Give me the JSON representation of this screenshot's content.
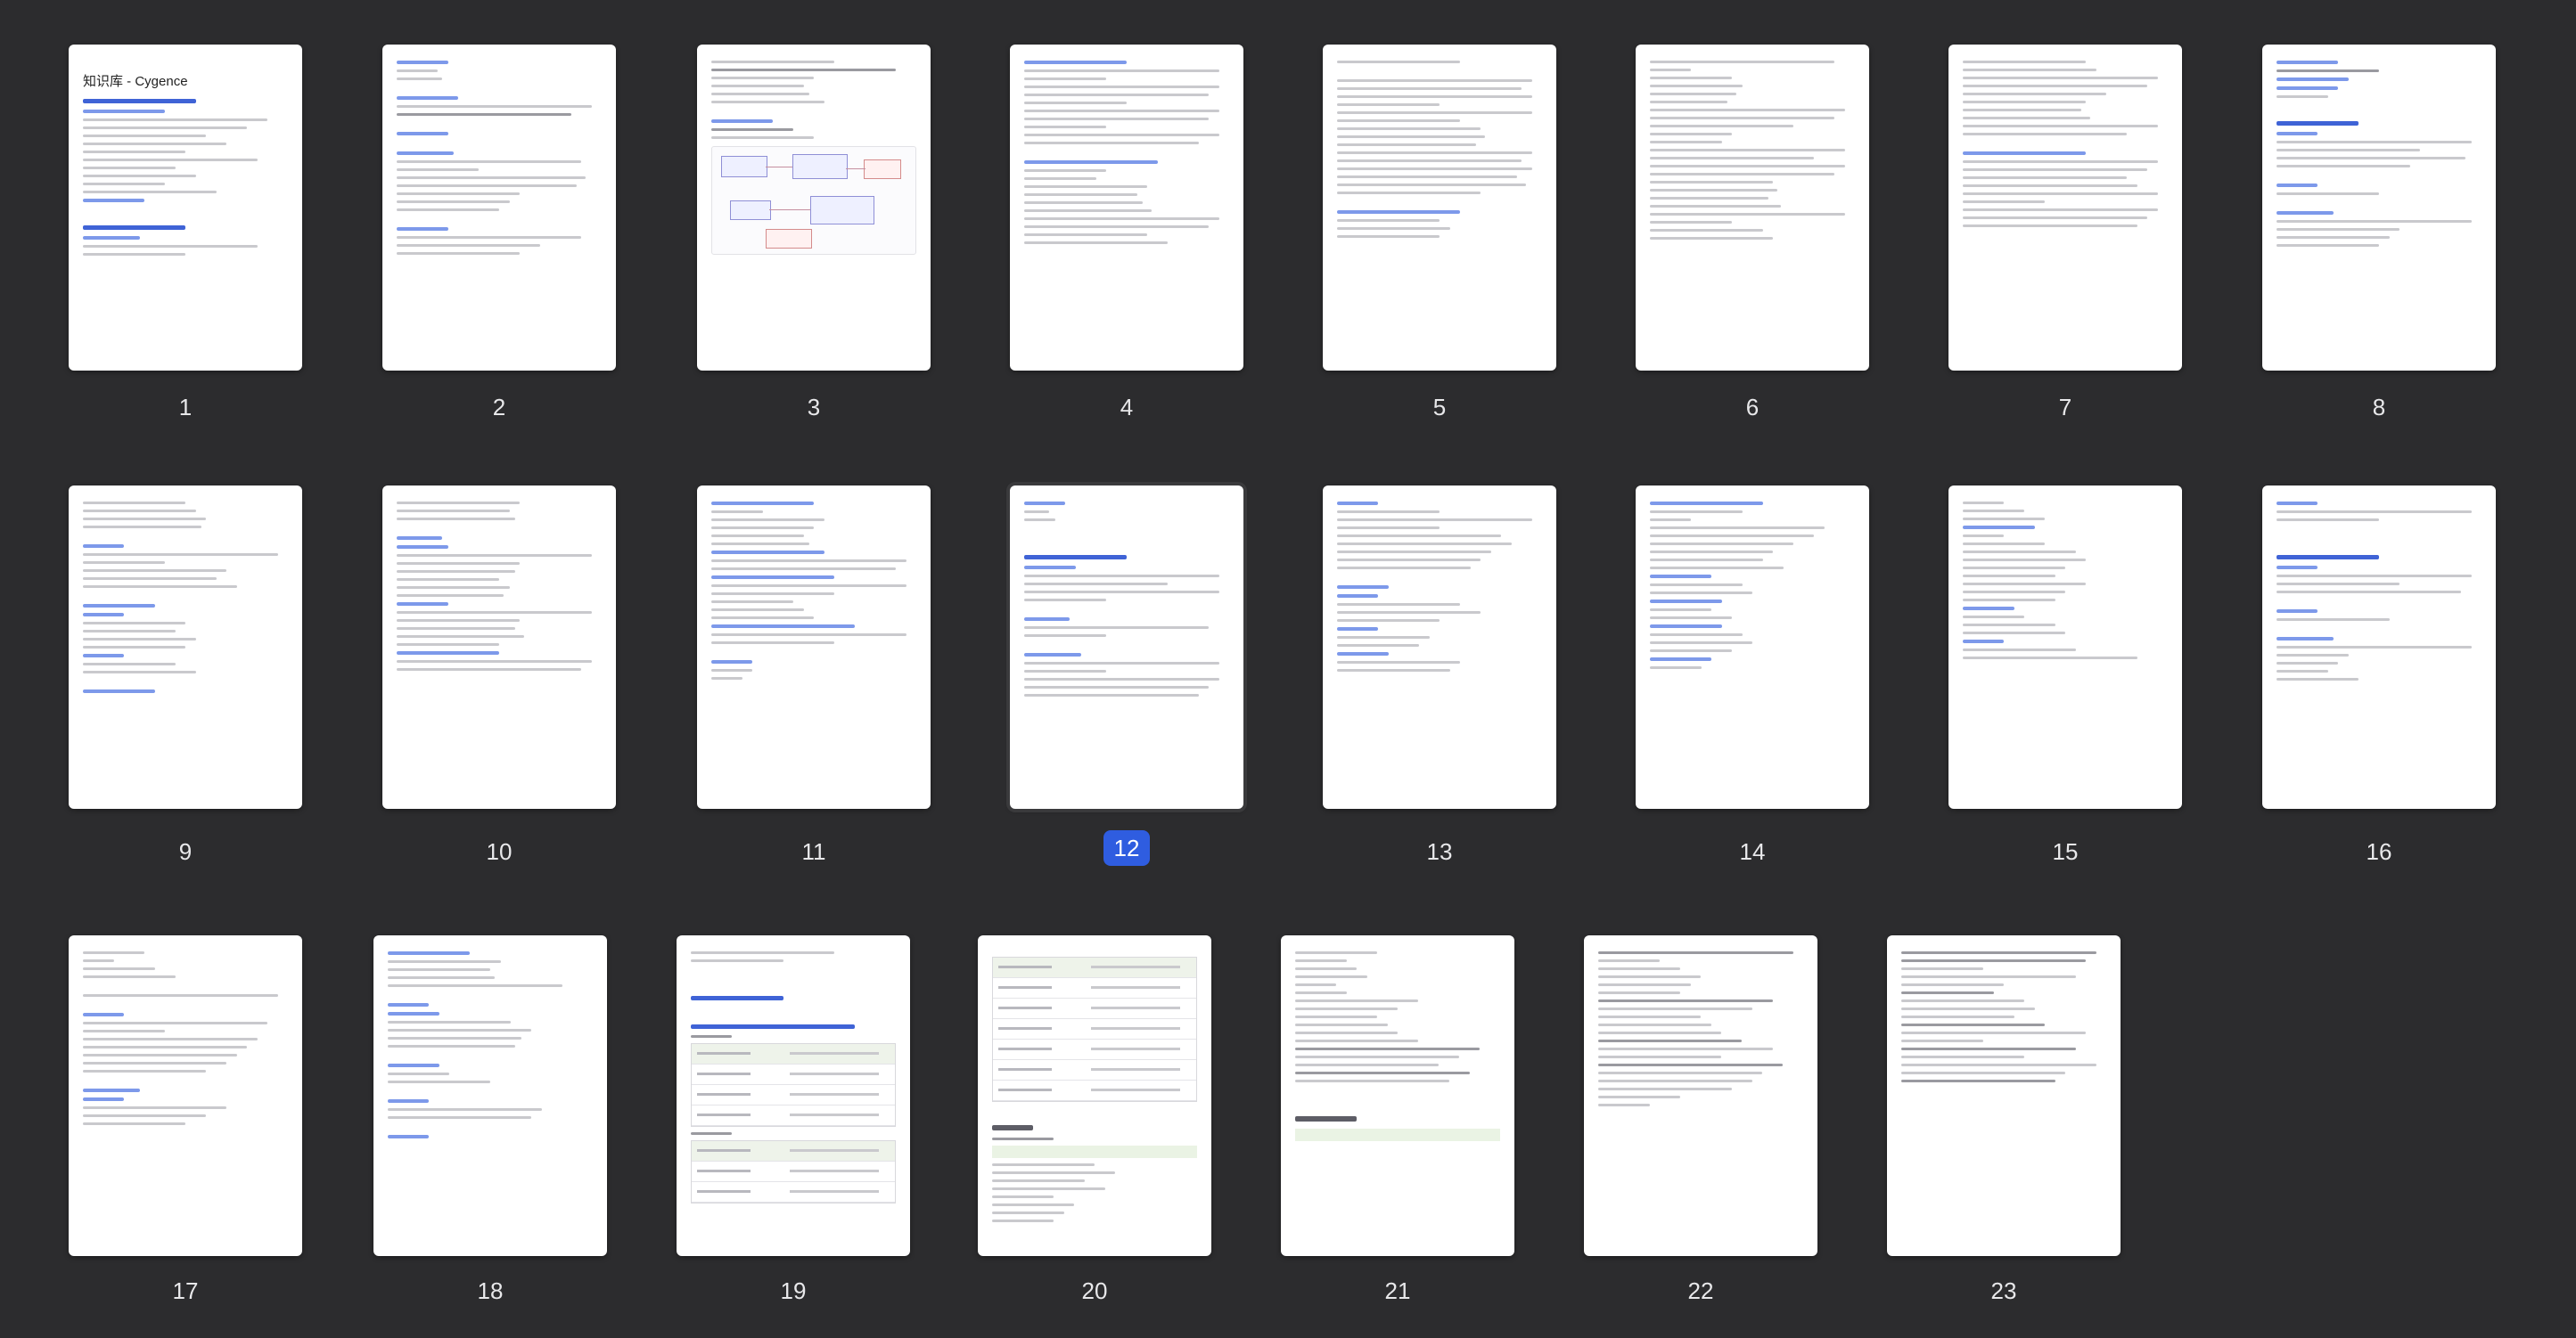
{
  "viewer": {
    "background": "#2c2c2e",
    "accent": "#2f5de0",
    "selected_page": "12"
  },
  "pages": [
    {
      "label": "1",
      "heading": "知识库 - Cygence"
    },
    {
      "label": "2"
    },
    {
      "label": "3"
    },
    {
      "label": "4"
    },
    {
      "label": "5"
    },
    {
      "label": "6"
    },
    {
      "label": "7"
    },
    {
      "label": "8"
    },
    {
      "label": "9"
    },
    {
      "label": "10"
    },
    {
      "label": "11"
    },
    {
      "label": "12"
    },
    {
      "label": "13"
    },
    {
      "label": "14"
    },
    {
      "label": "15"
    },
    {
      "label": "16"
    },
    {
      "label": "17"
    },
    {
      "label": "18"
    },
    {
      "label": "19"
    },
    {
      "label": "20"
    },
    {
      "label": "21"
    },
    {
      "label": "22"
    },
    {
      "label": "23"
    }
  ]
}
